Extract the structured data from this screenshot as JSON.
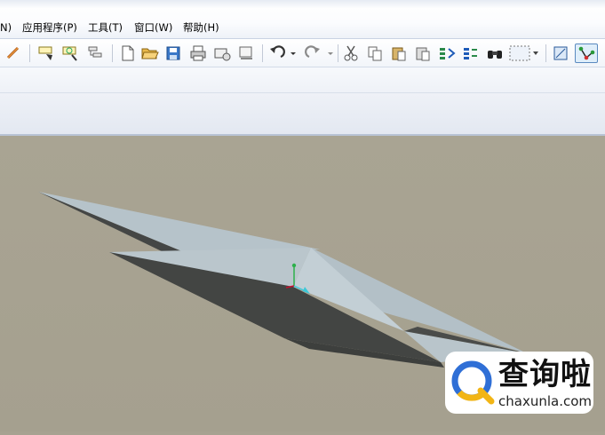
{
  "menubar": {
    "items": [
      {
        "label": "N)"
      },
      {
        "label": "应用程序(P)"
      },
      {
        "label": "工具(T)"
      },
      {
        "label": "窗口(W)"
      },
      {
        "label": "帮助(H)"
      }
    ]
  },
  "toolbar": {
    "icons": [
      "link-icon",
      "select-tool-icon",
      "filter-tool-icon",
      "tree-tool-icon",
      "new-file-icon",
      "open-folder-icon",
      "save-icon",
      "print-icon",
      "send-mail-icon",
      "close-window-icon",
      "undo-icon",
      "redo-icon",
      "cut-icon",
      "copy-icon",
      "paste-icon",
      "paste-special-icon",
      "regenerate-icon",
      "regenerate-manager-icon",
      "find-icon",
      "selection-box-icon",
      "view-window-icon",
      "datum-display-icon"
    ]
  },
  "viewport": {
    "background": "#a7a291",
    "model_color": "#b9c6cd",
    "shadow_color": "#454745",
    "axes": {
      "x": "#c8102e",
      "y": "#2db04b",
      "z": "#3cc8d8"
    }
  },
  "watermark": {
    "title": "查询啦",
    "subtitle": "chaxunla.com",
    "accent": "#2f6fd6",
    "accent2": "#f2b515"
  }
}
